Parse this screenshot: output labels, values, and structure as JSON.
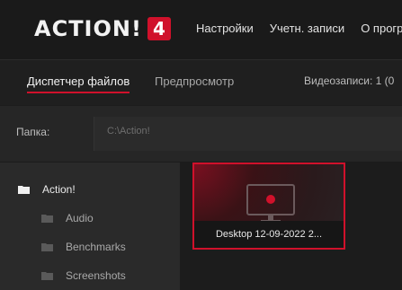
{
  "app": {
    "logo_text": "ACTION!",
    "logo_version": "4",
    "accent": "#d0112b"
  },
  "topnav": {
    "items": [
      {
        "label": "Настройки"
      },
      {
        "label": "Учетн. записи"
      },
      {
        "label": "О прогр"
      }
    ]
  },
  "tabs": {
    "file_manager": "Диспетчер файлов",
    "preview": "Предпросмотр",
    "recordings_count": "Видеозаписи: 1 (0"
  },
  "folder": {
    "label": "Папка:",
    "path": "C:\\Action!"
  },
  "tree": {
    "root": "Action!",
    "children": [
      "Audio",
      "Benchmarks",
      "Screenshots"
    ]
  },
  "recordings": [
    {
      "title": "Desktop 12-09-2022 2...",
      "icon": "monitor-record-icon",
      "selected": true
    }
  ]
}
